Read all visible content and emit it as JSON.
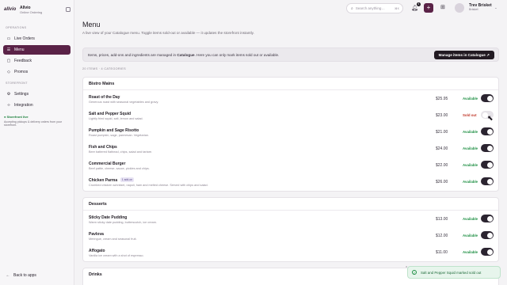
{
  "brand": {
    "logo": "allvio",
    "name": "Allvio",
    "subtitle": "Online Ordering"
  },
  "sidebar": {
    "section_operations": "OPERATIONS",
    "section_storefront": "STOREFRONT",
    "items": [
      {
        "label": "Live Orders",
        "icon": "live-orders-icon",
        "active": false
      },
      {
        "label": "Menu",
        "icon": "menu-icon",
        "active": true
      },
      {
        "label": "Feedback",
        "icon": "feedback-icon",
        "active": false
      },
      {
        "label": "Promos",
        "icon": "promos-icon",
        "active": false
      },
      {
        "label": "Settings",
        "icon": "settings-icon",
        "active": false
      },
      {
        "label": "Integration",
        "icon": "integration-icon",
        "active": false
      }
    ],
    "store_status": {
      "title": "● Storefront live",
      "text": "Accepting pickups & delivery orders from your storefront."
    },
    "back_link": "Back to apps"
  },
  "topbar": {
    "search_placeholder": "Search anything…",
    "search_shortcut": "⌘K",
    "notification_count": "4",
    "user_name": "Trev Brisket",
    "user_role": "Brisket"
  },
  "page": {
    "title": "Menu",
    "description": "A live view of your Catalogue menu. Toggle items sold-out or available — it updates the storefront instantly.",
    "banner_text_prefix": "Items, prices, add-ons and ingredients are managed in ",
    "banner_text_bold": "Catalogue",
    "banner_text_suffix": ". Here you can only mark items sold out or available.",
    "manage_button": "Manage items in Catalogue ↗",
    "counts": "20 ITEMS · 4 CATEGORIES"
  },
  "categories": [
    {
      "title": "Bistro Mains",
      "items": [
        {
          "name": "Roast of the Day",
          "desc": "Generous roast with seasonal vegetables and gravy.",
          "price": "$25.95",
          "status": "Available",
          "available": true,
          "tag": ""
        },
        {
          "name": "Salt and Pepper Squid",
          "desc": "Lightly fried squid, salt, lemon and salad.",
          "price": "$23.00",
          "status": "Sold out",
          "available": false,
          "tag": ""
        },
        {
          "name": "Pumpkin and Sage Risotto",
          "desc": "Roast pumpkin, sage, parmesan. Vegetarian.",
          "price": "$21.00",
          "status": "Available",
          "available": true,
          "tag": ""
        },
        {
          "name": "Fish and Chips",
          "desc": "Beer battered flathead, chips, salad and tartare.",
          "price": "$24.00",
          "status": "Available",
          "available": true,
          "tag": ""
        },
        {
          "name": "Commercial Burger",
          "desc": "Beef pattie, cheese, sauce, pickles and chips.",
          "price": "$22.00",
          "status": "Available",
          "available": true,
          "tag": ""
        },
        {
          "name": "Chicken Parma",
          "desc": "Crumbed chicken schnitzel, napoli, ham and melted cheese. Served with chips and salad.",
          "price": "$26.00",
          "status": "Available",
          "available": true,
          "tag": "1 add-on"
        }
      ]
    },
    {
      "title": "Desserts",
      "items": [
        {
          "name": "Sticky Date Pudding",
          "desc": "Warm sticky date pudding, butterscotch, ice cream.",
          "price": "$13.00",
          "status": "Available",
          "available": true,
          "tag": ""
        },
        {
          "name": "Pavlova",
          "desc": "Meringue, cream and seasonal fruit.",
          "price": "$12.00",
          "status": "Available",
          "available": true,
          "tag": ""
        },
        {
          "name": "Affogato",
          "desc": "Vanilla ice cream with a shot of espresso.",
          "price": "$11.00",
          "status": "Available",
          "available": true,
          "tag": ""
        }
      ]
    },
    {
      "title": "Drinks",
      "items": []
    }
  ],
  "toast": {
    "message": "Salt and Pepper Squid marked sold out"
  },
  "colors": {
    "accent": "#5a2247",
    "available": "#1f8f44",
    "sold_out": "#c0392b"
  }
}
